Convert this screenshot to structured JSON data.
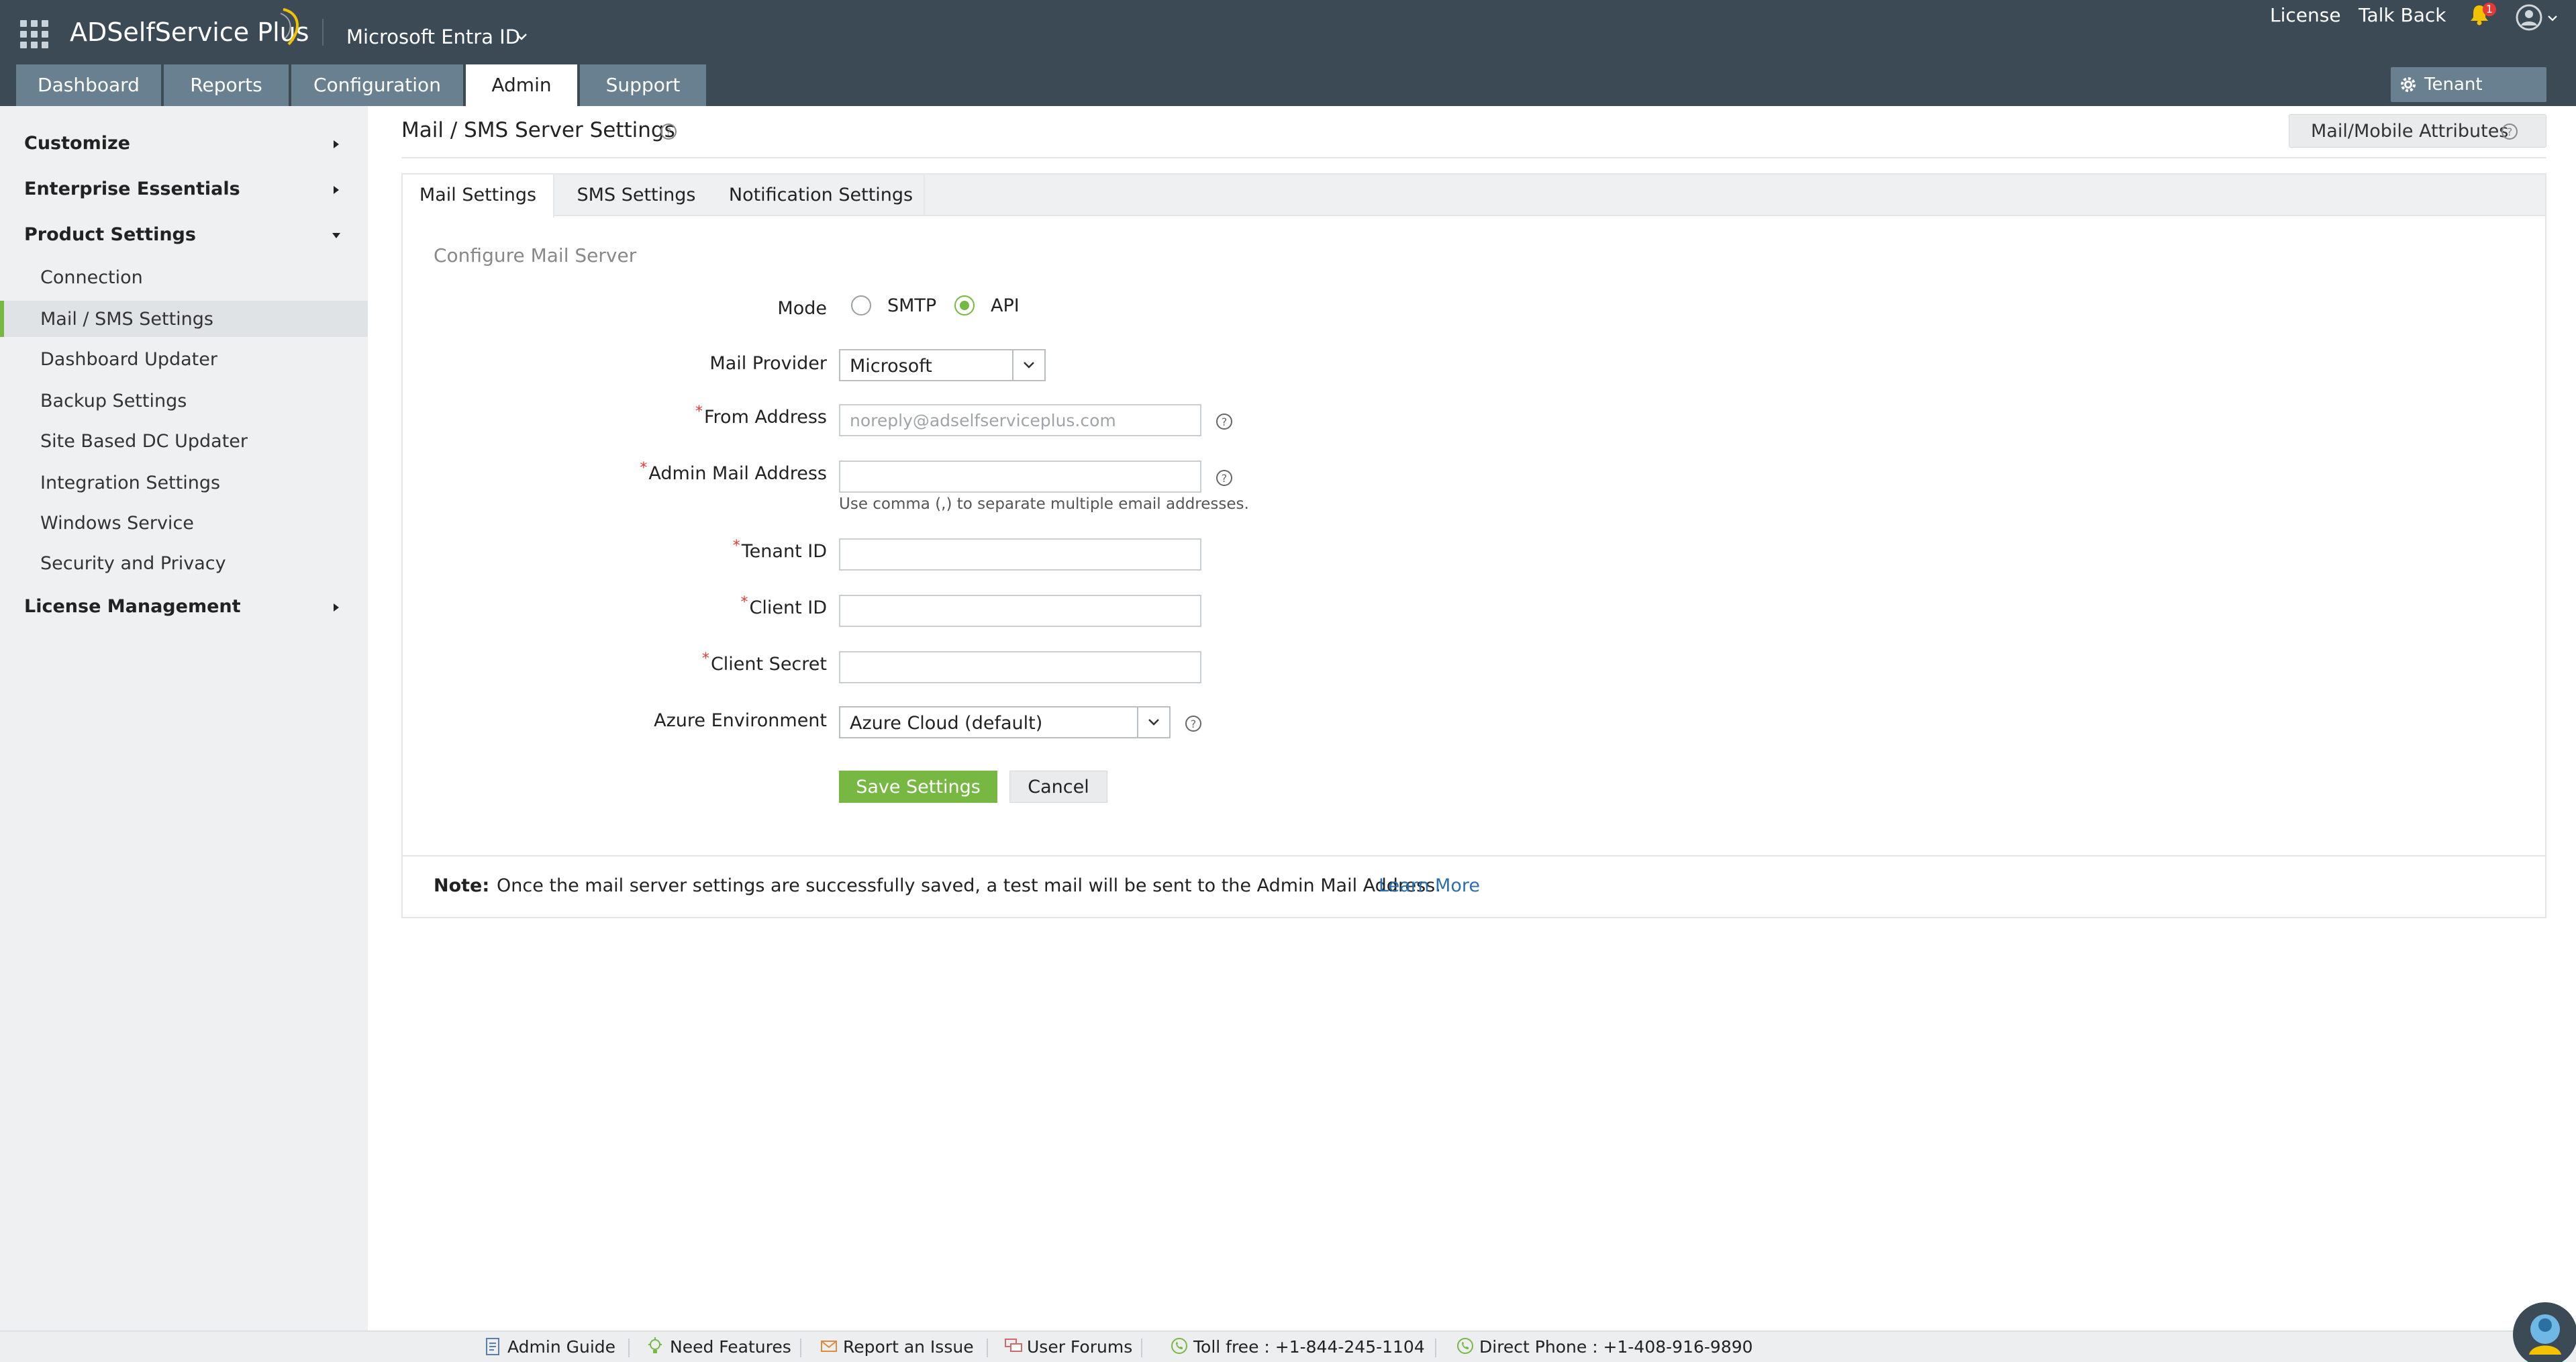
{
  "header": {
    "app_name": "ADSelfService Plus",
    "tenant": "Microsoft Entra ID",
    "links": {
      "license": "License",
      "talk_back": "Talk Back"
    },
    "notification_count": "1",
    "accent": "#f2c200"
  },
  "nav": {
    "tabs": [
      {
        "label": "Dashboard"
      },
      {
        "label": "Reports"
      },
      {
        "label": "Configuration"
      },
      {
        "label": "Admin",
        "active": true
      },
      {
        "label": "Support"
      }
    ],
    "tenant_settings": "Tenant Settings"
  },
  "sidebar": {
    "groups": [
      {
        "label": "Customize"
      },
      {
        "label": "Enterprise Essentials"
      },
      {
        "label": "Product Settings"
      },
      {
        "label": "License Management"
      }
    ],
    "items": [
      {
        "label": "Connection"
      },
      {
        "label": "Mail / SMS Settings",
        "active": true
      },
      {
        "label": "Dashboard Updater"
      },
      {
        "label": "Backup Settings"
      },
      {
        "label": "Site Based DC Updater"
      },
      {
        "label": "Integration Settings"
      },
      {
        "label": "Windows Service"
      },
      {
        "label": "Security and Privacy"
      }
    ]
  },
  "page": {
    "title": "Mail / SMS Server Settings",
    "attributes_button": "Mail/Mobile Attributes"
  },
  "tabs": [
    {
      "label": "Mail Settings",
      "active": true
    },
    {
      "label": "SMS Settings"
    },
    {
      "label": "Notification Settings"
    }
  ],
  "form": {
    "section_title": "Configure Mail Server",
    "mode": {
      "label": "Mode",
      "options": [
        "SMTP",
        "API"
      ],
      "selected": "API"
    },
    "mail_provider": {
      "label": "Mail Provider",
      "value": "Microsoft"
    },
    "from_address": {
      "label": "From Address",
      "value": "",
      "placeholder": "noreply@adselfserviceplus.com"
    },
    "admin_mail": {
      "label": "Admin Mail Address",
      "value": "",
      "hint": "Use comma (,) to separate multiple email addresses."
    },
    "tenant_id": {
      "label": "Tenant ID",
      "value": ""
    },
    "client_id": {
      "label": "Client ID",
      "value": ""
    },
    "client_secret": {
      "label": "Client Secret",
      "value": ""
    },
    "azure_env": {
      "label": "Azure Environment",
      "value": "Azure Cloud (default)"
    },
    "required_mark": "*",
    "save": "Save Settings",
    "cancel": "Cancel"
  },
  "note": {
    "label": "Note:",
    "text": "Once the mail server settings are successfully saved, a test mail will be sent to the Admin Mail Address.",
    "link": "Learn More"
  },
  "footer": {
    "admin_guide": "Admin Guide",
    "need_features": "Need Features",
    "report_issue": "Report an Issue",
    "user_forums": "User Forums",
    "toll_free": "Toll free : +1-844-245-1104",
    "direct_phone": "Direct Phone : +1-408-916-9890"
  },
  "colors": {
    "header_bg": "#3c4a55",
    "tab_bg": "#68808f",
    "primary_green": "#77b843",
    "link_blue": "#2a6fb0",
    "required_red": "#e53935"
  }
}
